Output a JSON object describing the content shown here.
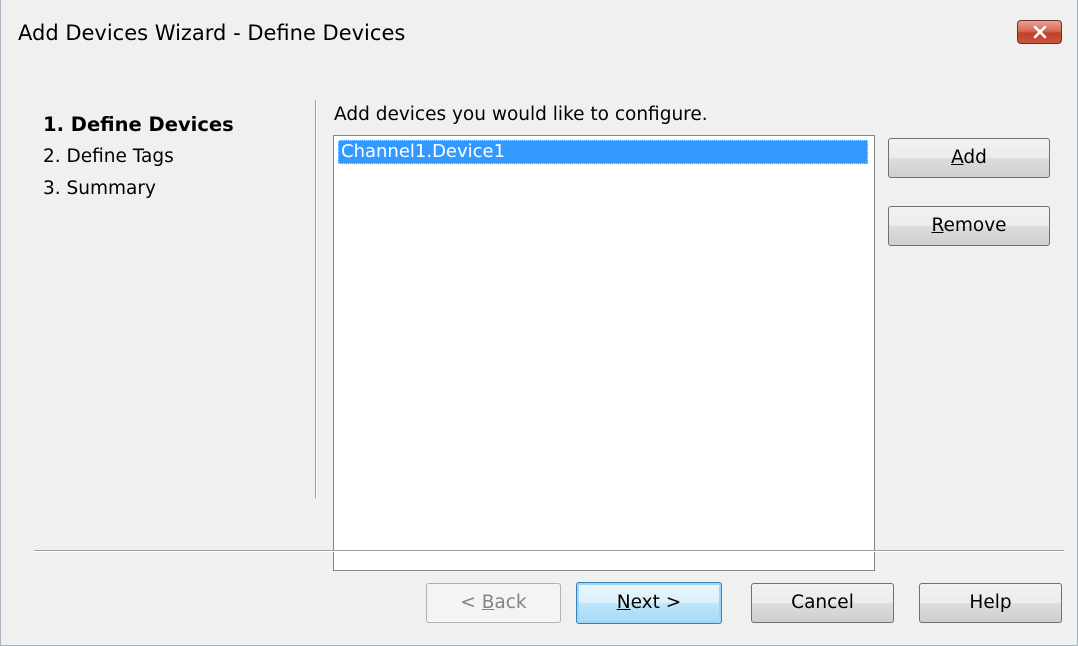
{
  "window": {
    "title": "Add Devices Wizard - Define Devices",
    "close_icon": "close-icon"
  },
  "steps": [
    {
      "label": "1. Define Devices",
      "active": true
    },
    {
      "label": "2. Define Tags",
      "active": false
    },
    {
      "label": "3. Summary",
      "active": false
    }
  ],
  "main": {
    "instruction": "Add devices you would like to configure.",
    "devices": [
      {
        "label": "Channel1.Device1",
        "selected": true
      }
    ]
  },
  "side_buttons": {
    "add": {
      "mnemonic": "A",
      "rest": "dd"
    },
    "remove": {
      "mnemonic": "R",
      "rest": "emove"
    }
  },
  "footer": {
    "back": {
      "prefix": "< ",
      "mnemonic": "B",
      "rest": "ack",
      "enabled": false
    },
    "next": {
      "mnemonic": "N",
      "rest": "ext >",
      "default": true
    },
    "cancel": {
      "label": "Cancel"
    },
    "help": {
      "label": "Help"
    }
  },
  "colors": {
    "selection": "#3399ff",
    "close_button": "#c7432e",
    "dialog_background": "#f0f0f0"
  }
}
